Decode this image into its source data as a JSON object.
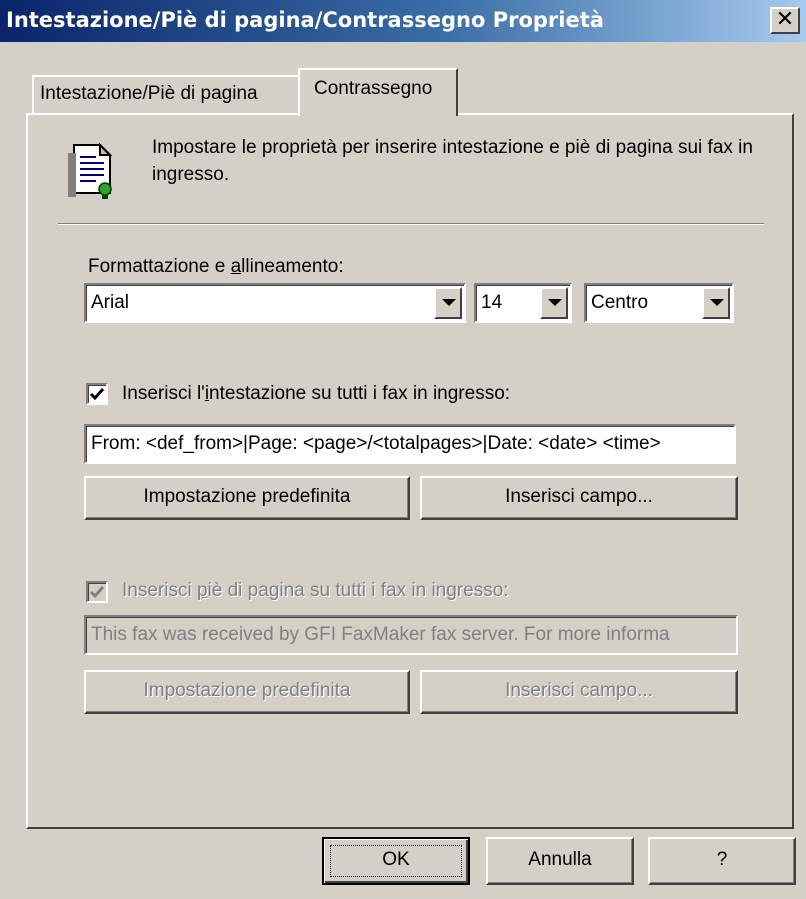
{
  "window": {
    "title": "Intestazione/Piè di pagina/Contrassegno Proprietà",
    "close_glyph": "✕"
  },
  "tabs": [
    {
      "label": "Intestazione/Piè di pagina",
      "selected": false
    },
    {
      "label": "Contrassegno",
      "selected": true
    }
  ],
  "description": {
    "icon": "document-properties-icon",
    "text": "Impostare le proprietà per inserire intestazione e piè di pagina sui fax in ingresso."
  },
  "formatting": {
    "label_pre": "Formattazione e ",
    "label_accel": "a",
    "label_post": "llineamento:",
    "font": "Arial",
    "size": "14",
    "alignment": "Centro"
  },
  "header_section": {
    "checkbox_pre": "Inserisci l'",
    "checkbox_accel": "i",
    "checkbox_post": "ntestazione su tutti i fax in ingresso:",
    "checked": true,
    "enabled": true,
    "value": "From: <def_from>|Page: <page>/<totalpages>|Date: <date> <time>",
    "default_button": "Impostazione predefinita",
    "insert_button": "Inserisci campo..."
  },
  "footer_section": {
    "checkbox_pre": "Inserisci ",
    "checkbox_accel": "p",
    "checkbox_post": "iè di pagina su tutti i fax in ingresso:",
    "checked": true,
    "enabled": false,
    "value": "This fax was received by GFI FaxMaker fax server. For more informa",
    "default_button": "Impostazione predefinita",
    "insert_button": "Inserisci campo..."
  },
  "footer_buttons": {
    "ok": "OK",
    "cancel": "Annulla",
    "help": "?"
  },
  "colors": {
    "face": "#d4d0c8",
    "title_start": "#0a246a",
    "title_end": "#a6caf0",
    "disabled_text": "#808080"
  }
}
